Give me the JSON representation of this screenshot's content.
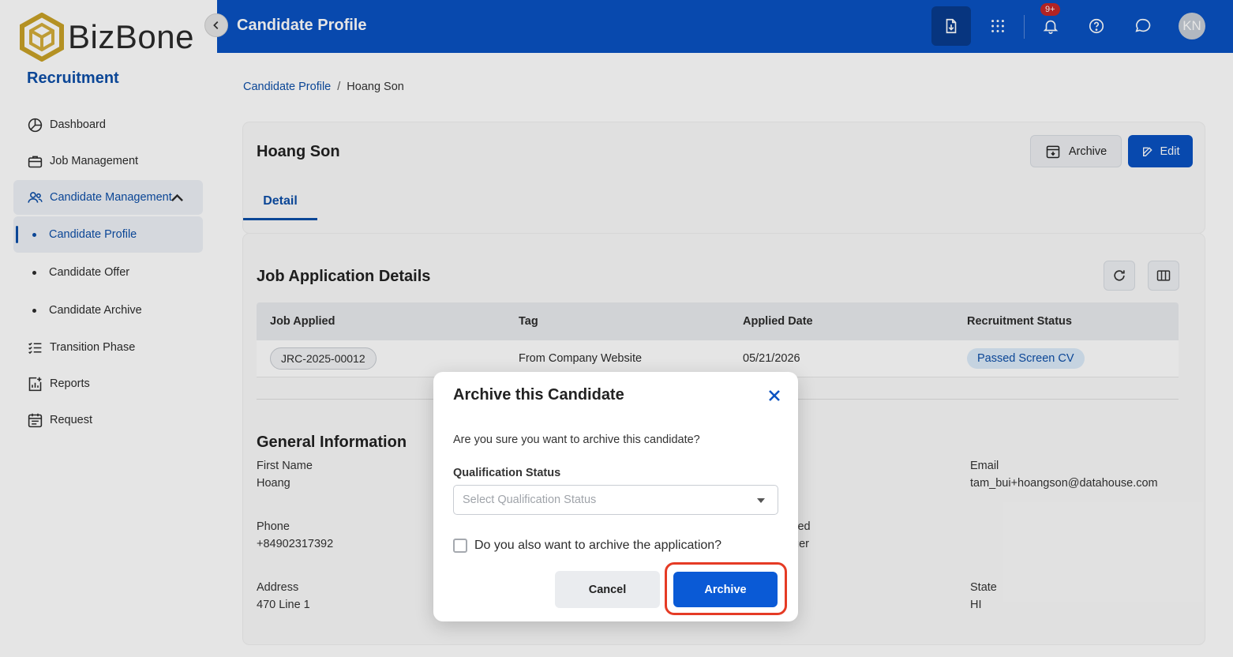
{
  "brand": {
    "name": "BizBone",
    "module": "Recruitment"
  },
  "sidebar": {
    "items": [
      {
        "label": "Dashboard"
      },
      {
        "label": "Job Management"
      },
      {
        "label": "Candidate Management"
      },
      {
        "label": "Candidate Profile"
      },
      {
        "label": "Candidate Offer"
      },
      {
        "label": "Candidate Archive"
      },
      {
        "label": "Transition Phase"
      },
      {
        "label": "Reports"
      },
      {
        "label": "Request"
      }
    ]
  },
  "header": {
    "title": "Candidate Profile",
    "notification_badge": "9+",
    "avatar_initials": "KN",
    "color": "#0a52c2"
  },
  "breadcrumb": {
    "parent": "Candidate Profile",
    "separator": "/",
    "current": "Hoang Son"
  },
  "profile": {
    "name": "Hoang Son",
    "archive_label": "Archive",
    "edit_label": "Edit",
    "tab_detail": "Detail"
  },
  "job_application": {
    "title": "Job Application Details",
    "columns": [
      "Job Applied",
      "Tag",
      "Applied Date",
      "Recruitment Status"
    ],
    "rows": [
      {
        "job": "JRC-2025-00012",
        "tag": "From Company Website",
        "date": "05/21/2026",
        "status": "Passed Screen CV"
      }
    ]
  },
  "general": {
    "title": "General Information",
    "first_name_label": "First Name",
    "first_name": "Hoang",
    "email_label": "Email",
    "email": "tam_bui+hoangson@datahouse.com",
    "phone_label": "Phone",
    "phone": "+84902317392",
    "partial_label": "lied",
    "partial_value": "ger",
    "address_label": "Address",
    "address": "470 Line 1",
    "state_label": "State",
    "state": "HI"
  },
  "modal": {
    "title": "Archive this Candidate",
    "message": "Are you sure you want to archive this candidate?",
    "qualification_label": "Qualification Status",
    "qualification_placeholder": "Select Qualification Status",
    "checkbox_label": "Do you also want to archive the application?",
    "cancel_label": "Cancel",
    "archive_label": "Archive",
    "highlight_color": "#e53b25"
  }
}
